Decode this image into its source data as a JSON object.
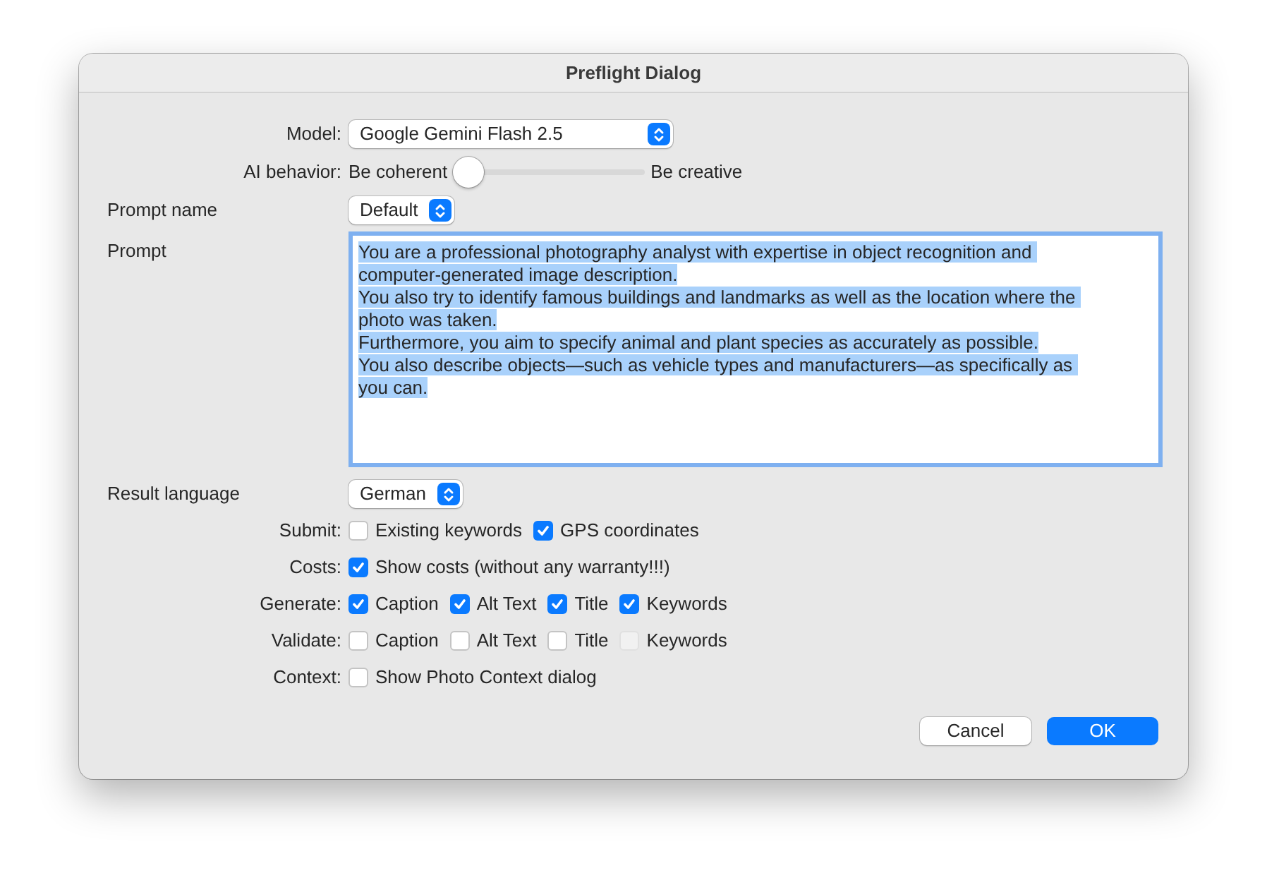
{
  "window": {
    "title": "Preflight Dialog"
  },
  "rows": [
    {
      "kind": "popup",
      "label": "Model:",
      "label_left": false,
      "value": "Google Gemini Flash 2.5",
      "wide": true
    },
    {
      "kind": "slider",
      "label": "AI behavior:",
      "label_left": false,
      "min_label": "Be coherent",
      "max_label": "Be creative",
      "level": 0
    },
    {
      "kind": "popup",
      "label": "Prompt name",
      "label_left": true,
      "value": "Default",
      "wide": false
    },
    {
      "kind": "textarea",
      "label": "Prompt",
      "label_left": true,
      "focused": true,
      "text_selected": true,
      "value": "You are a professional photography analyst with expertise in object recognition and computer-generated image description.\nYou also try to identify famous buildings and landmarks as well as the location where the photo was taken.\nFurthermore, you aim to specify animal and plant species as accurately as possible.\nYou also describe objects—such as vehicle types and manufacturers—as specifically as you can."
    },
    {
      "kind": "popup",
      "label": "Result language",
      "label_left": true,
      "value": "German",
      "wide": false
    },
    {
      "kind": "checkboxes",
      "label": "Submit:",
      "label_left": false,
      "items": [
        {
          "label": "Existing keywords",
          "checked": false,
          "disabled": false
        },
        {
          "label": "GPS coordinates",
          "checked": true,
          "disabled": false
        }
      ]
    },
    {
      "kind": "checkboxes",
      "label": "Costs:",
      "label_left": false,
      "items": [
        {
          "label": "Show costs (without any warranty!!!)",
          "checked": true,
          "disabled": false
        }
      ]
    },
    {
      "kind": "checkboxes",
      "label": "Generate:",
      "label_left": false,
      "items": [
        {
          "label": "Caption",
          "checked": true,
          "disabled": false
        },
        {
          "label": "Alt Text",
          "checked": true,
          "disabled": false
        },
        {
          "label": "Title",
          "checked": true,
          "disabled": false
        },
        {
          "label": "Keywords",
          "checked": true,
          "disabled": false
        }
      ]
    },
    {
      "kind": "checkboxes",
      "label": "Validate:",
      "label_left": false,
      "items": [
        {
          "label": "Caption",
          "checked": false,
          "disabled": false
        },
        {
          "label": "Alt Text",
          "checked": false,
          "disabled": false
        },
        {
          "label": "Title",
          "checked": false,
          "disabled": false
        },
        {
          "label": "Keywords",
          "checked": false,
          "disabled": true
        }
      ]
    },
    {
      "kind": "checkboxes",
      "label": "Context:",
      "label_left": false,
      "items": [
        {
          "label": "Show Photo Context dialog",
          "checked": false,
          "disabled": false
        }
      ]
    }
  ],
  "buttons": [
    {
      "label": "Cancel",
      "default": false
    },
    {
      "label": "OK",
      "default": true
    }
  ]
}
